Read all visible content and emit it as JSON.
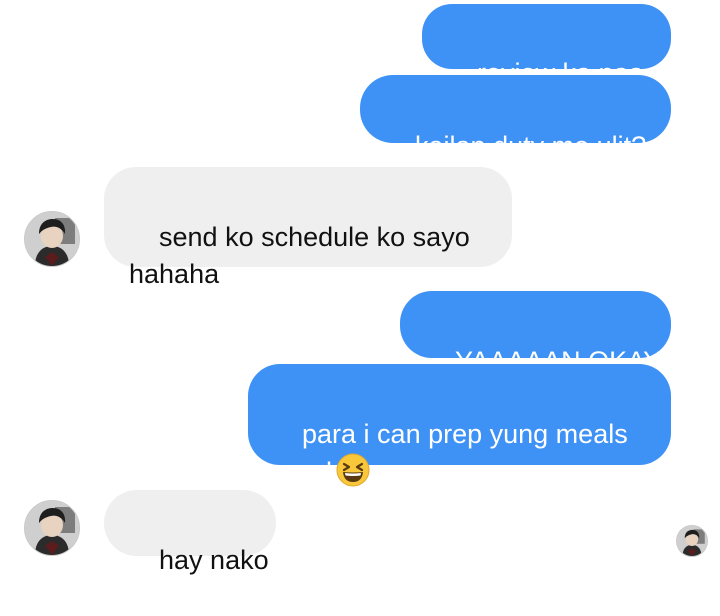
{
  "messages": [
    {
      "from": "me",
      "text": "review ka naaa"
    },
    {
      "from": "me",
      "text": "kailan duty mo ulit?"
    },
    {
      "from": "them",
      "text": "send ko schedule ko sayo\nhahaha"
    },
    {
      "from": "me",
      "text": "YAAAAAN OKAY"
    },
    {
      "from": "me",
      "text": "para i can prep yung meals\nagad",
      "emoji": "grinning-squinting-face-emoji"
    },
    {
      "from": "them",
      "text": "hay nako"
    }
  ],
  "colors": {
    "outgoing_bubble": "#3f92f5",
    "incoming_bubble": "#efefef",
    "outgoing_text": "#ffffff",
    "incoming_text": "#111111"
  },
  "icons": {
    "contact_avatar": "contact-avatar-icon",
    "read_receipt": "read-receipt-avatar-icon"
  }
}
